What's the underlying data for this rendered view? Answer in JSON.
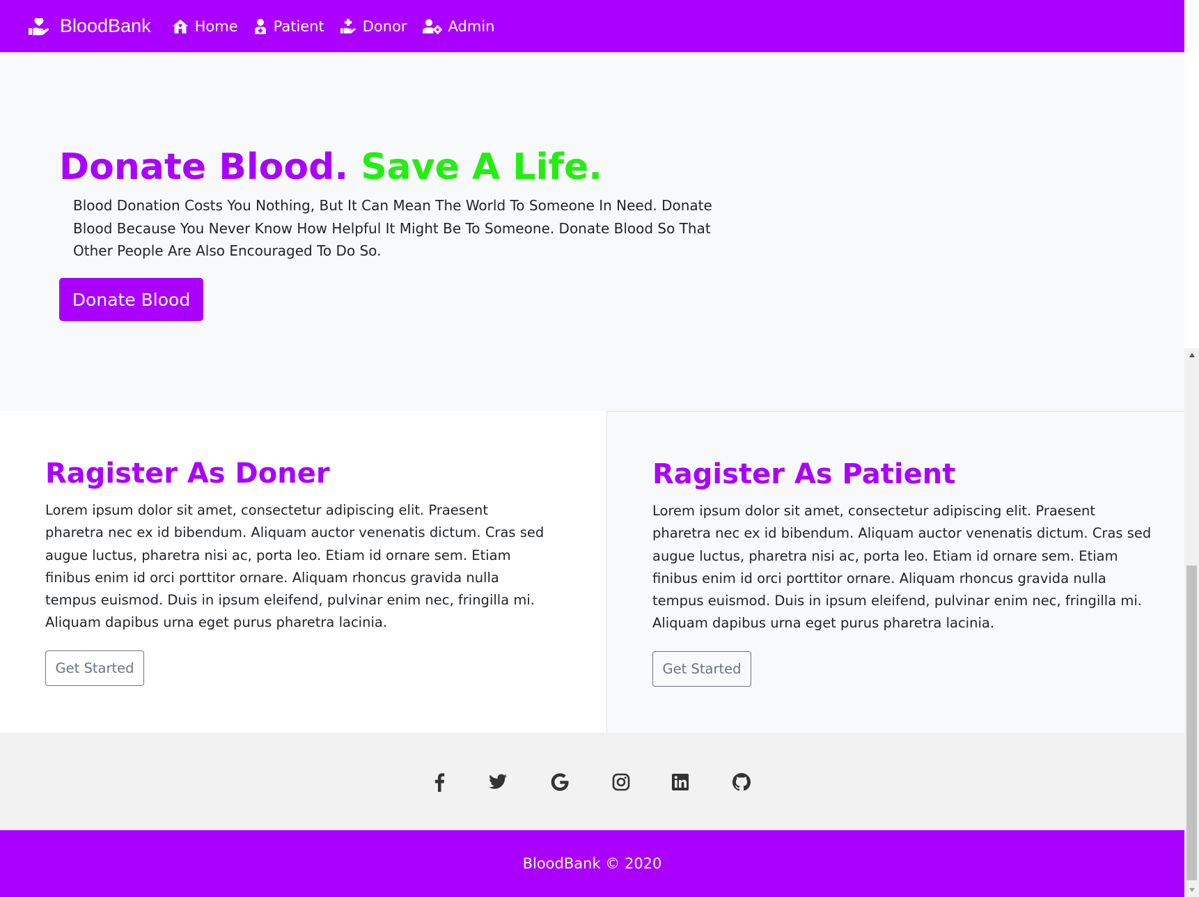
{
  "colors": {
    "brand_purple": "#aa00ff",
    "accent_green": "#22ee11",
    "hero_bg": "#f8f9fa",
    "social_bg": "#f2f2f2",
    "icon_dark": "#333333"
  },
  "navbar": {
    "brand_label": "BloodBank",
    "brand_icon": "hand-holding-heart-icon",
    "links": [
      {
        "label": "Home",
        "icon": "home-icon"
      },
      {
        "label": "Patient",
        "icon": "patient-icon"
      },
      {
        "label": "Donor",
        "icon": "hand-holding-medical-icon"
      },
      {
        "label": "Admin",
        "icon": "user-cog-icon"
      }
    ]
  },
  "hero": {
    "title_part1": "Donate Blood.",
    "title_part2": "Save A Life.",
    "text": "Blood Donation Costs You Nothing, But It Can Mean The World To Someone In Need. Donate Blood Because You Never Know How Helpful It Might Be To Someone. Donate Blood So That Other People Are Also Encouraged To Do So.",
    "button_label": "Donate Blood"
  },
  "cards": [
    {
      "title": "Ragister As Doner",
      "text": "Lorem ipsum dolor sit amet, consectetur adipiscing elit. Praesent pharetra nec ex id bibendum. Aliquam auctor venenatis dictum. Cras sed augue luctus, pharetra nisi ac, porta leo. Etiam id ornare sem. Etiam finibus enim id orci porttitor ornare. Aliquam rhoncus gravida nulla tempus euismod. Duis in ipsum eleifend, pulvinar enim nec, fringilla mi. Aliquam dapibus urna eget purus pharetra lacinia.",
      "button_label": "Get Started"
    },
    {
      "title": "Ragister As Patient",
      "text": "Lorem ipsum dolor sit amet, consectetur adipiscing elit. Praesent pharetra nec ex id bibendum. Aliquam auctor venenatis dictum. Cras sed augue luctus, pharetra nisi ac, porta leo. Etiam id ornare sem. Etiam finibus enim id orci porttitor ornare. Aliquam rhoncus gravida nulla tempus euismod. Duis in ipsum eleifend, pulvinar enim nec, fringilla mi. Aliquam dapibus urna eget purus pharetra lacinia.",
      "button_label": "Get Started"
    }
  ],
  "social_icons": [
    "facebook-icon",
    "twitter-icon",
    "google-icon",
    "instagram-icon",
    "linkedin-icon",
    "github-icon"
  ],
  "footer": {
    "text": "BloodBank © 2020"
  }
}
